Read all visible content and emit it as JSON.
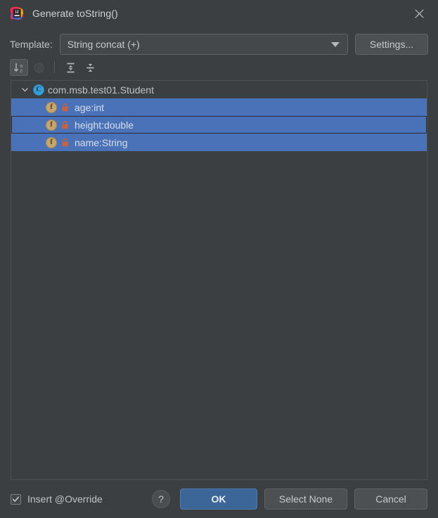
{
  "window": {
    "title": "Generate toString()",
    "app_icon": "intellij-idea-logo",
    "close_icon": "close-icon"
  },
  "template_row": {
    "label": "Template:",
    "combobox": {
      "value": "String concat (+)",
      "arrow_icon": "chevron-down-icon"
    },
    "settings_label": "Settings..."
  },
  "toolbar": {
    "buttons": [
      {
        "name": "sort-alphabetically-button",
        "icon": "sort-alphabetically-icon",
        "state": "selected",
        "tooltip": "Sort by name"
      },
      {
        "name": "sort-by-kind-button",
        "icon": "circle-icon",
        "state": "disabled",
        "tooltip": "Group"
      },
      {
        "name": "expand-all-button",
        "icon": "expand-all-icon",
        "state": "normal",
        "tooltip": "Expand All"
      },
      {
        "name": "collapse-all-button",
        "icon": "collapse-all-icon",
        "state": "normal",
        "tooltip": "Collapse All"
      }
    ]
  },
  "tree": {
    "root": {
      "label": "com.msb.test01.Student",
      "icon": "class-icon",
      "icon_letter": "C",
      "expanded": true,
      "chevron_icon": "chevron-down-icon",
      "selected": false
    },
    "fields": [
      {
        "label": "age:int",
        "icon": "field-icon",
        "icon_letter": "f",
        "visibility_icon": "lock-icon",
        "selected": true,
        "focused": false
      },
      {
        "label": "height:double",
        "icon": "field-icon",
        "icon_letter": "f",
        "visibility_icon": "lock-icon",
        "selected": true,
        "focused": true
      },
      {
        "label": "name:String",
        "icon": "field-icon",
        "icon_letter": "f",
        "visibility_icon": "lock-icon",
        "selected": true,
        "focused": false
      }
    ]
  },
  "footer": {
    "insert_override": {
      "label": "Insert @Override",
      "checked": true,
      "check_icon": "checkmark-icon"
    },
    "help_label": "?",
    "ok_label": "OK",
    "select_none_label": "Select None",
    "cancel_label": "Cancel"
  },
  "colors": {
    "dialog_background": "#3C3F41",
    "panel_background": "#3C3F41",
    "selection_blue": "#4A72B8",
    "primary_button": "#3C6598",
    "class_icon": "#389FD6",
    "field_icon": "#C5A46D",
    "lock_icon": "#CB603C",
    "text": "#BEC2C4"
  }
}
